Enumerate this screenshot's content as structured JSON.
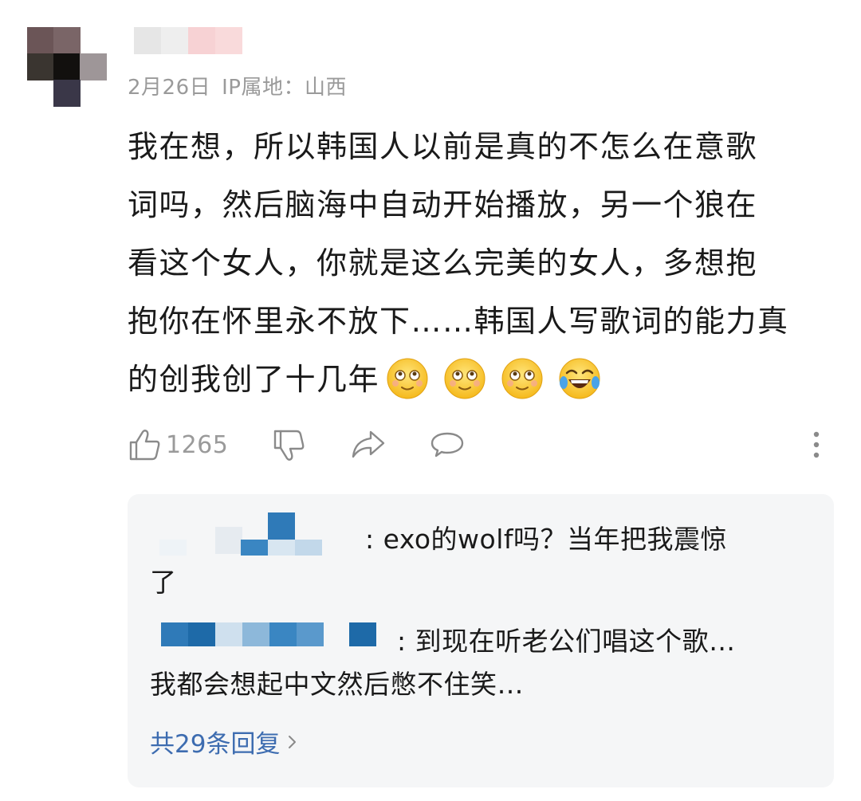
{
  "comment": {
    "meta_date": "2月26日",
    "meta_ip": "IP属地：山西",
    "lines": [
      "我在想，所以韩国人以前是真的不怎么在意歌",
      "词吗，然后脑海中自动开始播放，另一个狼在",
      "看这个女人，你就是这么完美的女人，多想抱",
      "抱你在怀里永不放下……韩国人写歌词的能力真",
      "的创我创了十几年"
    ],
    "emojis": [
      "relieved-face-icon",
      "relieved-face-icon",
      "relieved-face-icon",
      "tears-of-joy-icon"
    ]
  },
  "actions": {
    "like_count": "1265",
    "icons": [
      "thumbs-up-icon",
      "thumbs-down-icon",
      "share-icon",
      "comment-icon",
      "more-vertical-icon"
    ]
  },
  "replies": {
    "items": [
      {
        "text_line1": ": exo的wolf吗？当年把我震惊",
        "text_line2": "了"
      },
      {
        "text_line1": ": 到现在听老公们唱这个歌…",
        "text_line2": "我都会想起中文然后憋不住笑…"
      }
    ],
    "more_label": "共29条回复"
  },
  "colors": {
    "meta_gray": "#9a9a9a",
    "link_blue": "#3d6cb0",
    "panel_bg": "#f5f6f7"
  }
}
